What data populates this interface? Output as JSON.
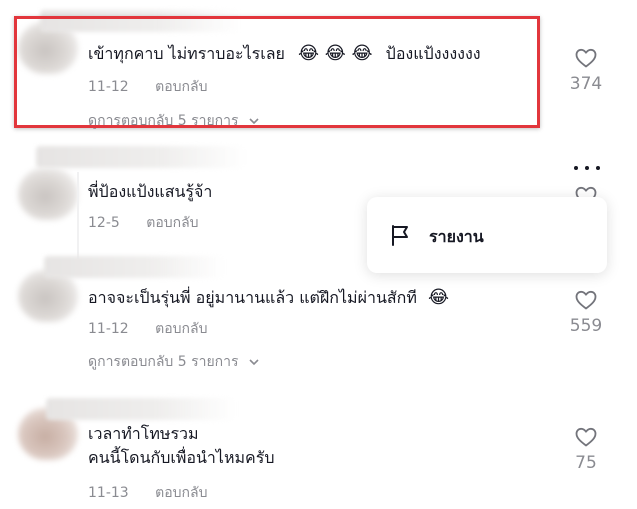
{
  "colors": {
    "highlight": "#e2363c",
    "meta_text": "#8a8b91",
    "primary_text": "#161823"
  },
  "comments": [
    {
      "text": "เข้าทุกคาบ ไม่ทราบอะไรเลย",
      "emojis": "😂 😂 😂",
      "text_tail": "ป้องแป้งงงงงง",
      "date": "11-12",
      "reply_label": "ตอบกลับ",
      "view_replies": "ดูการตอบกลับ 5 รายการ",
      "likes": "374",
      "heart_icon": "heart-outline-icon"
    },
    {
      "text": "พี่ป้องแป้งแสนรู้จ้า",
      "date": "12-5",
      "reply_label": "ตอบกลับ"
    },
    {
      "text": "อาจจะเป็นรุ่นพี่ อยู่มานานแล้ว แต่ฝึกไม่ผ่านสักที",
      "emojis": "😂",
      "date": "11-12",
      "reply_label": "ตอบกลับ",
      "view_replies": "ดูการตอบกลับ 5 รายการ",
      "likes": "559"
    },
    {
      "text_line1": "เวลาทำโทษรวม",
      "text_line2": "คนนี้โดนกับเพื่อนำไหมครับ",
      "date": "11-13",
      "reply_label": "ตอบกลับ",
      "likes": "75"
    }
  ],
  "popover": {
    "report_label": "รายงาน",
    "icon": "flag-icon"
  }
}
